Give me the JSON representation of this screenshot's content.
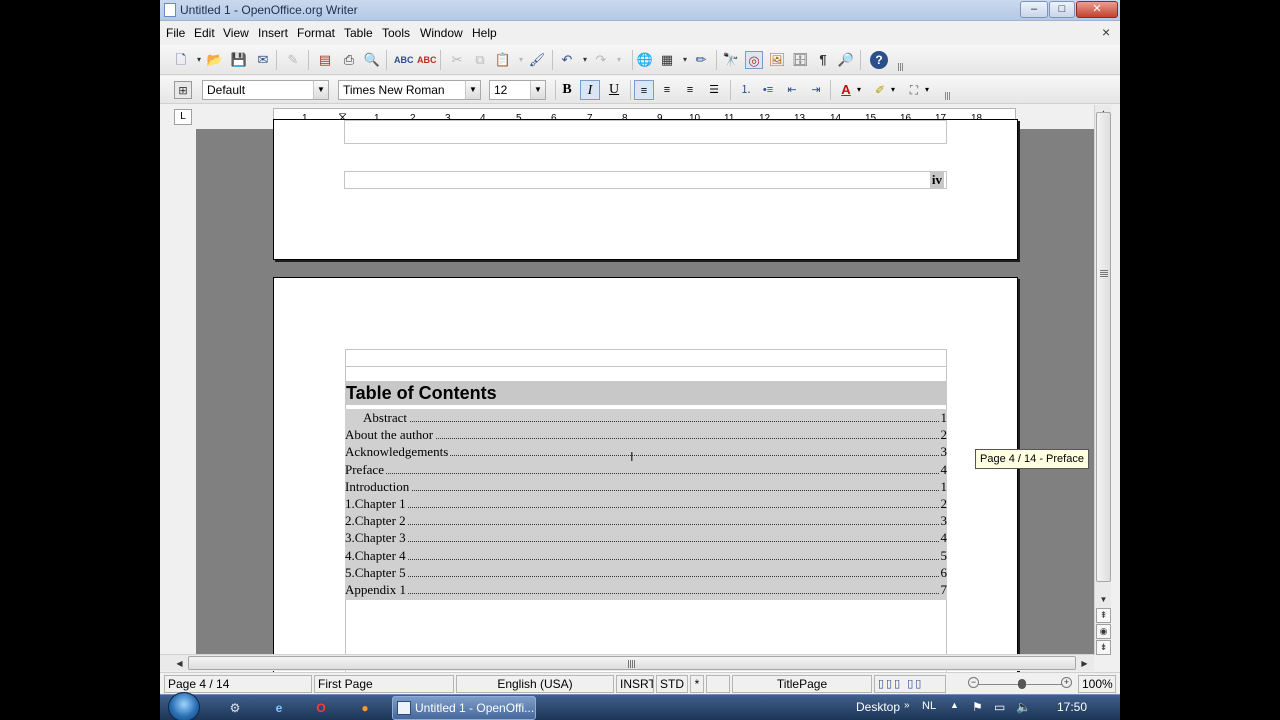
{
  "window": {
    "title": "Untitled 1 - OpenOffice.org Writer",
    "min_glyph": "–",
    "max_glyph": "□",
    "close_glyph": "✕"
  },
  "menu": [
    "File",
    "Edit",
    "View",
    "Insert",
    "Format",
    "Table",
    "Tools",
    "Window",
    "Help"
  ],
  "menu_close_glyph": "×",
  "formatting": {
    "style": "Default",
    "font": "Times New Roman",
    "size": "12",
    "bold_label": "B",
    "italic_label": "I",
    "underline_label": "U"
  },
  "ruler": {
    "corner": "L",
    "ticks": [
      "1",
      "1",
      "2",
      "3",
      "4",
      "5",
      "6",
      "7",
      "8",
      "9",
      "10",
      "11",
      "12",
      "13",
      "14",
      "15",
      "16",
      "17",
      "18"
    ]
  },
  "document": {
    "page_number_roman": "iv",
    "toc_title": "Table of Contents",
    "toc_entries": [
      {
        "label": "Abstract",
        "page": "1",
        "indent": true
      },
      {
        "label": "About the author",
        "page": "2"
      },
      {
        "label": "Acknowledgements",
        "page": "3"
      },
      {
        "label": "Preface",
        "page": "4"
      },
      {
        "label": "Introduction",
        "page": "1"
      },
      {
        "label": "1.Chapter 1",
        "page": "2"
      },
      {
        "label": "2.Chapter 2",
        "page": "3"
      },
      {
        "label": "3.Chapter 3",
        "page": "4"
      },
      {
        "label": "4.Chapter 4",
        "page": "5"
      },
      {
        "label": "5.Chapter 5",
        "page": "6"
      },
      {
        "label": "Appendix 1",
        "page": "7"
      }
    ]
  },
  "tooltip": "Page 4 / 14  - Preface",
  "statusbar": {
    "page": "Page 4 / 14",
    "page_style": "First Page",
    "language": "English (USA)",
    "insert_mode": "INSRT",
    "selection_mode": "STD",
    "modified": "*",
    "section": "TitlePage",
    "zoom": "100%"
  },
  "taskbar": {
    "window_button": "Untitled 1 - OpenOffi...",
    "desktop": "Desktop",
    "lang": "NL",
    "time": "17:50"
  },
  "colors": {
    "toc_shading": "#d0d0d0",
    "doc_background": "#808080",
    "titlebar": "#b4c9e6"
  }
}
